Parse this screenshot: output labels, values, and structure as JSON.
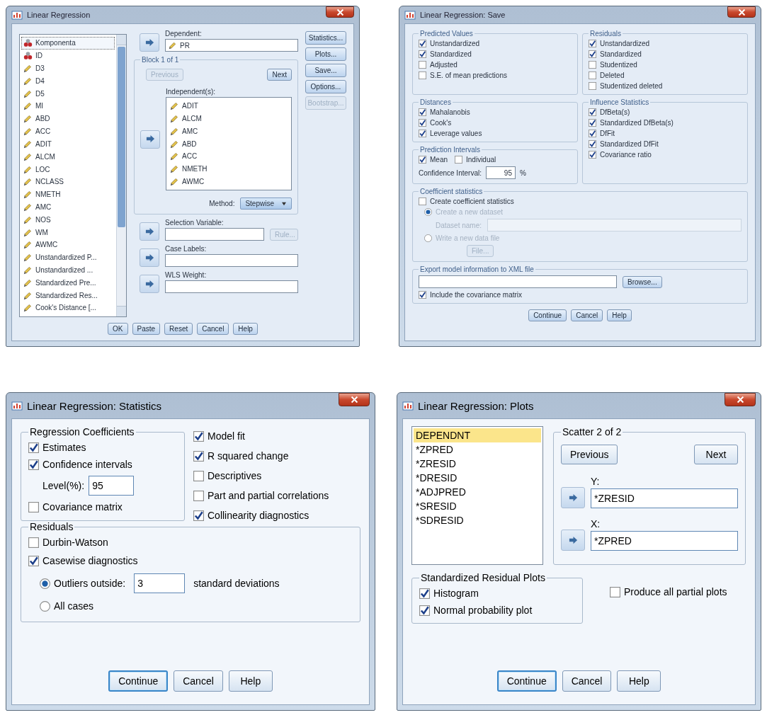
{
  "dialogs": [
    {
      "kind": "regression",
      "title": "Linear Regression",
      "variables": [
        {
          "name": "Komponenta",
          "kind": "nominal",
          "selected": true
        },
        {
          "name": "ID",
          "kind": "nominal",
          "selected": false
        },
        {
          "name": "D3",
          "kind": "scale",
          "selected": false
        },
        {
          "name": "D4",
          "kind": "scale",
          "selected": false
        },
        {
          "name": "D5",
          "kind": "scale",
          "selected": false
        },
        {
          "name": "MI",
          "kind": "scale",
          "selected": false
        },
        {
          "name": "ABD",
          "kind": "scale",
          "selected": false
        },
        {
          "name": "ACC",
          "kind": "scale",
          "selected": false
        },
        {
          "name": "ADIT",
          "kind": "scale",
          "selected": false
        },
        {
          "name": "ALCM",
          "kind": "scale",
          "selected": false
        },
        {
          "name": "LOC",
          "kind": "scale",
          "selected": false
        },
        {
          "name": "NCLASS",
          "kind": "scale",
          "selected": false
        },
        {
          "name": "NMETH",
          "kind": "scale",
          "selected": false
        },
        {
          "name": "AMC",
          "kind": "scale",
          "selected": false
        },
        {
          "name": "NOS",
          "kind": "scale",
          "selected": false
        },
        {
          "name": "WM",
          "kind": "scale",
          "selected": false
        },
        {
          "name": "AWMC",
          "kind": "scale",
          "selected": false
        },
        {
          "name": "Unstandardized P...",
          "kind": "scale",
          "selected": false
        },
        {
          "name": "Unstandardized ...",
          "kind": "scale",
          "selected": false
        },
        {
          "name": "Standardized Pre...",
          "kind": "scale",
          "selected": false
        },
        {
          "name": "Standardized Res...",
          "kind": "scale",
          "selected": false
        },
        {
          "name": "Cook's Distance [...",
          "kind": "scale",
          "selected": false
        }
      ],
      "dependent": {
        "label": "Dependent:",
        "value": "PR",
        "kind": "scale"
      },
      "block": {
        "label": "Block 1 of 1",
        "previous": {
          "label": "Previous",
          "disabled": true
        },
        "next": {
          "label": "Next",
          "disabled": false
        },
        "independent_label": "Independent(s):",
        "independents": [
          {
            "name": "ADIT",
            "kind": "scale"
          },
          {
            "name": "ALCM",
            "kind": "scale"
          },
          {
            "name": "AMC",
            "kind": "scale"
          },
          {
            "name": "ABD",
            "kind": "scale"
          },
          {
            "name": "ACC",
            "kind": "scale"
          },
          {
            "name": "NMETH",
            "kind": "scale"
          },
          {
            "name": "AWMC",
            "kind": "scale"
          }
        ],
        "method_label": "Method:",
        "method": "Stepwise"
      },
      "selection": {
        "label": "Selection Variable:",
        "rule": {
          "label": "Rule...",
          "disabled": true
        }
      },
      "case_labels": {
        "label": "Case Labels:"
      },
      "wls": {
        "label": "WLS Weight:"
      },
      "side_buttons": [
        {
          "label": "Statistics...",
          "disabled": false
        },
        {
          "label": "Plots...",
          "disabled": false
        },
        {
          "label": "Save...",
          "disabled": false
        },
        {
          "label": "Options...",
          "disabled": false
        },
        {
          "label": "Bootstrap...",
          "disabled": true
        }
      ],
      "buttons": [
        "OK",
        "Paste",
        "Reset",
        "Cancel",
        "Help"
      ]
    },
    {
      "kind": "save",
      "title": "Linear Regression: Save",
      "predicted_values": {
        "title": "Predicted Values",
        "items": [
          {
            "label": "Unstandardized",
            "checked": true
          },
          {
            "label": "Standardized",
            "checked": true
          },
          {
            "label": "Adjusted",
            "checked": false
          },
          {
            "label": "S.E. of mean predictions",
            "checked": false
          }
        ]
      },
      "residuals": {
        "title": "Residuals",
        "items": [
          {
            "label": "Unstandardized",
            "checked": true
          },
          {
            "label": "Standardized",
            "checked": true
          },
          {
            "label": "Studentized",
            "checked": false
          },
          {
            "label": "Deleted",
            "checked": false
          },
          {
            "label": "Studentized deleted",
            "checked": false
          }
        ]
      },
      "distances": {
        "title": "Distances",
        "items": [
          {
            "label": "Mahalanobis",
            "checked": true
          },
          {
            "label": "Cook's",
            "checked": true
          },
          {
            "label": "Leverage values",
            "checked": true
          }
        ]
      },
      "influence_statistics": {
        "title": "Influence Statistics",
        "items": [
          {
            "label": "DfBeta(s)",
            "checked": true
          },
          {
            "label": "Standardized DfBeta(s)",
            "checked": true
          },
          {
            "label": "DfFit",
            "checked": true
          },
          {
            "label": "Standardized DfFit",
            "checked": true
          },
          {
            "label": "Covariance ratio",
            "checked": true
          }
        ]
      },
      "prediction_intervals": {
        "title": "Prediction Intervals",
        "mean": {
          "label": "Mean",
          "checked": true
        },
        "individual": {
          "label": "Individual",
          "checked": false
        },
        "confidence_label": "Confidence Interval:",
        "confidence": "95",
        "unit": "%"
      },
      "coefficient_statistics": {
        "title": "Coefficient statistics",
        "create": {
          "label": "Create coefficient statistics",
          "checked": false
        },
        "disabled": true,
        "options": [
          {
            "label": "Create a new dataset",
            "selected": true
          },
          {
            "label": "Write a new data file",
            "selected": false
          }
        ],
        "dataset_label": "Dataset name:",
        "file_button": "File..."
      },
      "export": {
        "title": "Export model information to XML file",
        "browse": "Browse...",
        "include": {
          "label": "Include the covariance matrix",
          "checked": true
        }
      },
      "buttons": [
        "Continue",
        "Cancel",
        "Help"
      ]
    },
    {
      "kind": "statistics",
      "title": "Linear Regression: Statistics",
      "coefficients": {
        "title": "Regression Coefficients",
        "items": [
          {
            "label": "Estimates",
            "checked": true
          },
          {
            "label": "Confidence intervals",
            "checked": true
          }
        ],
        "level_label": "Level(%):",
        "level": "95",
        "covariance": {
          "label": "Covariance matrix",
          "checked": false
        }
      },
      "options": [
        {
          "label": "Model fit",
          "checked": true
        },
        {
          "label": "R squared change",
          "checked": true
        },
        {
          "label": "Descriptives",
          "checked": false
        },
        {
          "label": "Part and partial correlations",
          "checked": false
        },
        {
          "label": "Collinearity diagnostics",
          "checked": true
        }
      ],
      "residuals": {
        "title": "Residuals",
        "durbin_watson": {
          "label": "Durbin-Watson",
          "checked": false
        },
        "casewise": {
          "label": "Casewise diagnostics",
          "checked": true
        },
        "choices": [
          {
            "label": "Outliers outside:",
            "selected": true
          },
          {
            "label": "All cases",
            "selected": false
          }
        ],
        "outliers": "3",
        "unit": "standard deviations"
      },
      "buttons": [
        {
          "label": "Continue",
          "default": true
        },
        {
          "label": "Cancel",
          "default": false
        },
        {
          "label": "Help",
          "default": false
        }
      ]
    },
    {
      "kind": "plots",
      "title": "Linear Regression: Plots",
      "variables": [
        {
          "name": "DEPENDNT",
          "selected": true
        },
        {
          "name": "*ZPRED",
          "selected": false
        },
        {
          "name": "*ZRESID",
          "selected": false
        },
        {
          "name": "*DRESID",
          "selected": false
        },
        {
          "name": "*ADJPRED",
          "selected": false
        },
        {
          "name": "*SRESID",
          "selected": false
        },
        {
          "name": "*SDRESID",
          "selected": false
        }
      ],
      "scatter": {
        "title": "Scatter 2 of 2",
        "previous": "Previous",
        "next": "Next",
        "y_label": "Y:",
        "y": "*ZRESID",
        "x_label": "X:",
        "x": "*ZPRED"
      },
      "residual_plots": {
        "title": "Standardized Residual Plots",
        "items": [
          {
            "label": "Histogram",
            "checked": true
          },
          {
            "label": "Normal probability plot",
            "checked": true
          }
        ]
      },
      "partial": {
        "label": "Produce all partial plots",
        "checked": false
      },
      "buttons": [
        {
          "label": "Continue",
          "default": true
        },
        {
          "label": "Cancel",
          "default": false
        },
        {
          "label": "Help",
          "default": false
        }
      ]
    }
  ]
}
